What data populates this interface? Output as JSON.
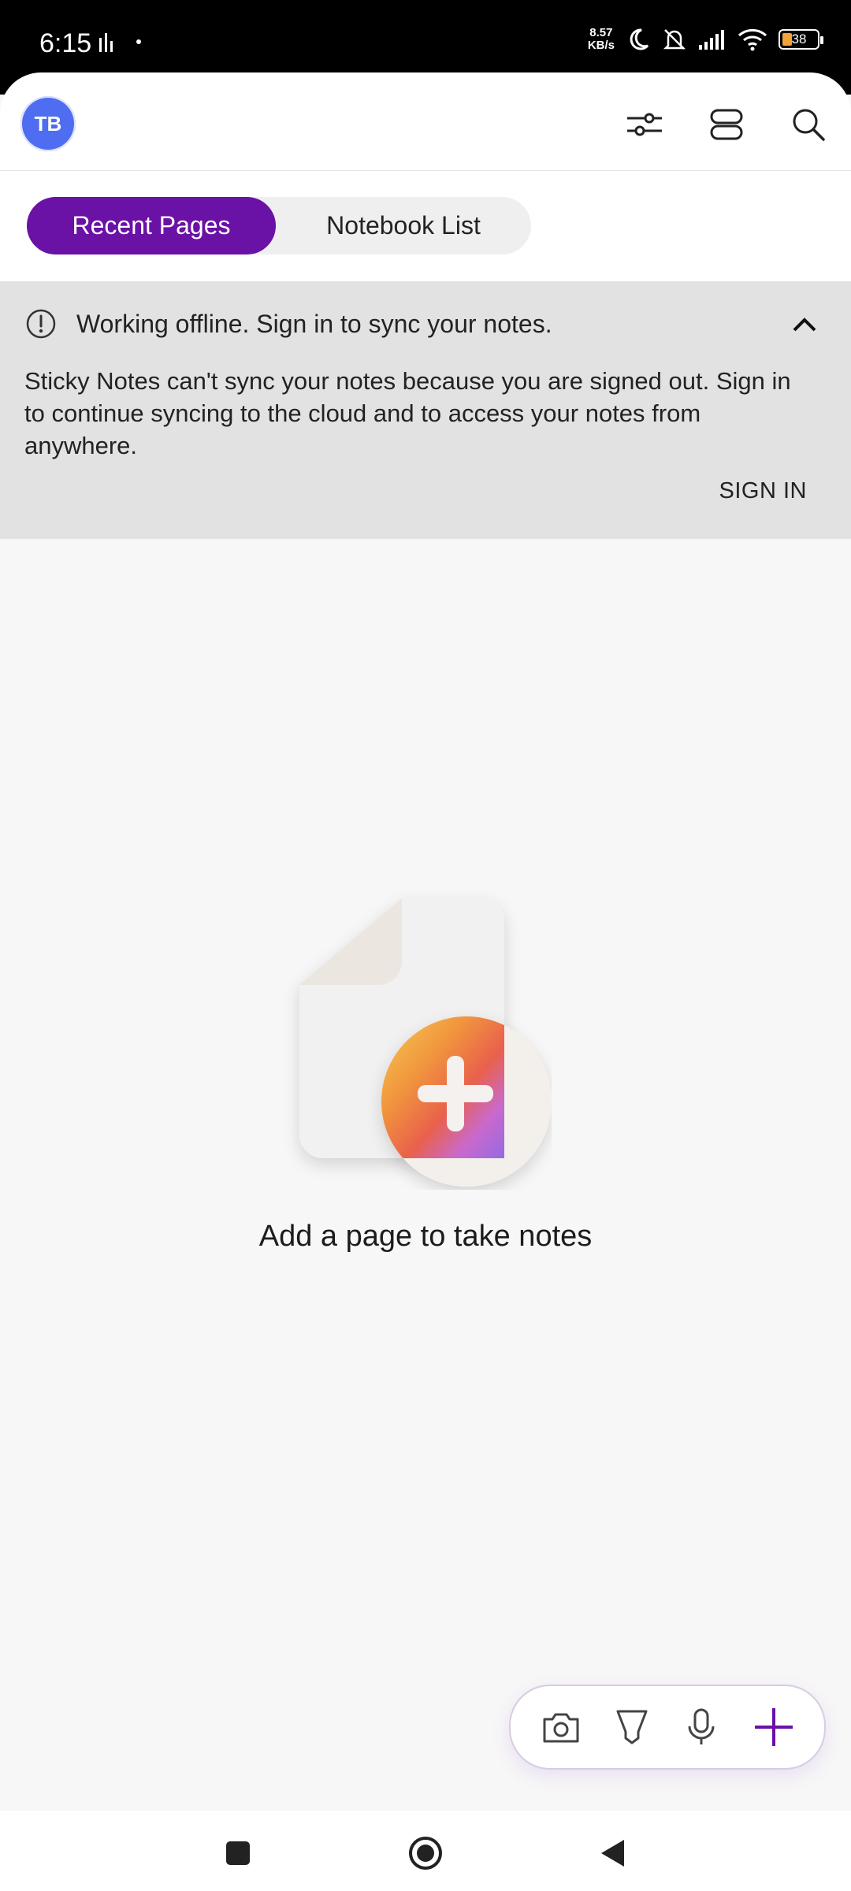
{
  "status_bar": {
    "time": "6:15",
    "net_speed_value": "8.57",
    "net_speed_unit": "KB/s",
    "battery_level": "38"
  },
  "app_bar": {
    "avatar_initials": "TB",
    "icons": [
      "sliders-icon",
      "layout-icon",
      "search-icon"
    ]
  },
  "tabs": [
    {
      "label": "Recent Pages",
      "selected": true
    },
    {
      "label": "Notebook List",
      "selected": false
    }
  ],
  "banner": {
    "title": "Working offline. Sign in to sync your notes.",
    "body": "Sticky Notes can't sync your notes because you are signed out. Sign in to continue syncing to the cloud and to access your notes from anywhere.",
    "action": "SIGN IN"
  },
  "empty_state": {
    "message": "Add a page to take notes"
  },
  "quick_actions": [
    "camera-icon",
    "marker-icon",
    "microphone-icon",
    "add-icon"
  ],
  "colors": {
    "accent": "#6a11a6",
    "avatar": "#4f6df0",
    "banner_bg": "#e2e2e2",
    "page_bg": "#f7f7f7"
  }
}
